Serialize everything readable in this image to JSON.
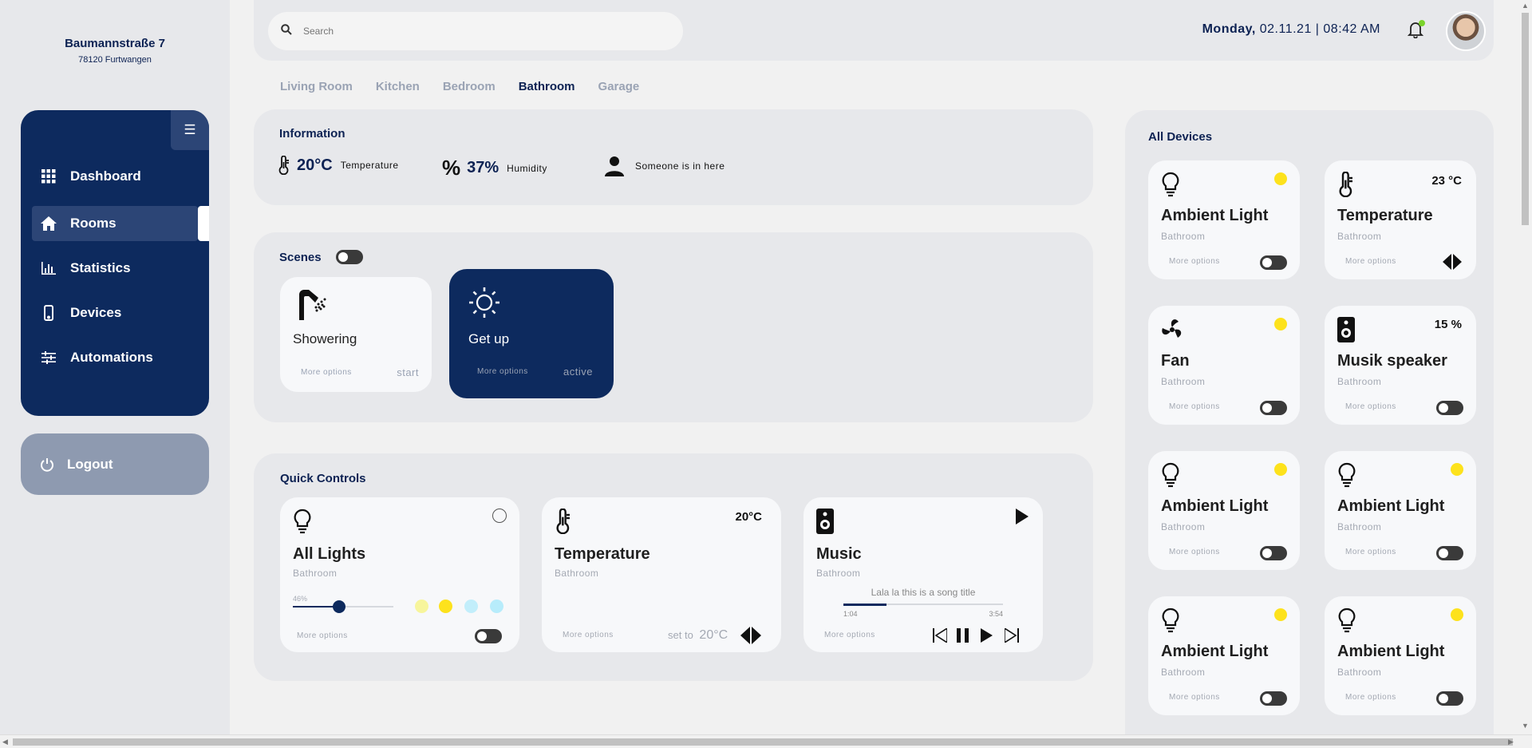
{
  "sidebar": {
    "street": "Baumannstraße 7",
    "city": "78120 Furtwangen",
    "menu_icon": "hamburger-icon",
    "items": [
      {
        "label": "Dashboard",
        "icon": "grid-icon"
      },
      {
        "label": "Rooms",
        "icon": "home-icon",
        "active": true
      },
      {
        "label": "Statistics",
        "icon": "bar-chart-icon"
      },
      {
        "label": "Devices",
        "icon": "phone-icon"
      },
      {
        "label": "Automations",
        "icon": "sliders-icon"
      }
    ],
    "logout": "Logout"
  },
  "header": {
    "search_placeholder": "Search",
    "day": "Monday,",
    "datetime": "02.11.21 | 08:42 AM",
    "notification_color": "#7ad32b"
  },
  "tabs": [
    "Living Room",
    "Kitchen",
    "Bedroom",
    "Bathroom",
    "Garage"
  ],
  "active_tab": "Bathroom",
  "information": {
    "title": "Information",
    "temperature": "20°C",
    "temperature_label": "Temperature",
    "humidity": "37%",
    "humidity_label": "Humidity",
    "presence_label": "Someone is in here"
  },
  "scenes": {
    "title": "Scenes",
    "items": [
      {
        "name": "Showering",
        "more": "More options",
        "status": "start",
        "icon": "shower-icon"
      },
      {
        "name": "Get up",
        "more": "More options",
        "status": "active",
        "icon": "sun-icon"
      }
    ]
  },
  "quick_controls": {
    "title": "Quick Controls",
    "lights": {
      "title": "All Lights",
      "room": "Bathroom",
      "brightness_label": "46%",
      "brightness": 0.46,
      "more": "More options",
      "colors": [
        "#f7f59c",
        "#fde21c",
        "#c2eefb",
        "#b7ecfb"
      ]
    },
    "temperature": {
      "title": "Temperature",
      "room": "Bathroom",
      "value": "20°C",
      "more": "More options",
      "set_to": "set to",
      "set_value": "20°C"
    },
    "music": {
      "title": "Music",
      "room": "Bathroom",
      "song": "Lala la this is a song title",
      "elapsed": "1:04",
      "total": "3:54",
      "progress": 0.27,
      "more": "More options"
    }
  },
  "all_devices": {
    "title": "All Devices",
    "items": [
      {
        "title": "Ambient Light",
        "room": "Bathroom",
        "more": "More options",
        "icon": "bulb-icon"
      },
      {
        "title": "Temperature",
        "room": "Bathroom",
        "more": "More options",
        "icon": "thermometer-icon",
        "value": "23 °C"
      },
      {
        "title": "Fan",
        "room": "Bathroom",
        "more": "More options",
        "icon": "fan-icon"
      },
      {
        "title": "Musik speaker",
        "room": "Bathroom",
        "more": "More options",
        "icon": "speaker-icon",
        "value": "15 %"
      },
      {
        "title": "Ambient Light",
        "room": "Bathroom",
        "more": "More options",
        "icon": "bulb-icon"
      },
      {
        "title": "Ambient Light",
        "room": "Bathroom",
        "more": "More options",
        "icon": "bulb-icon"
      },
      {
        "title": "Ambient Light",
        "room": "Bathroom",
        "more": "More options",
        "icon": "bulb-icon"
      },
      {
        "title": "Ambient Light",
        "room": "Bathroom",
        "more": "More options",
        "icon": "bulb-icon"
      }
    ]
  },
  "colors": {
    "navy": "#0d2a5e",
    "indicator": "#fde21c"
  }
}
